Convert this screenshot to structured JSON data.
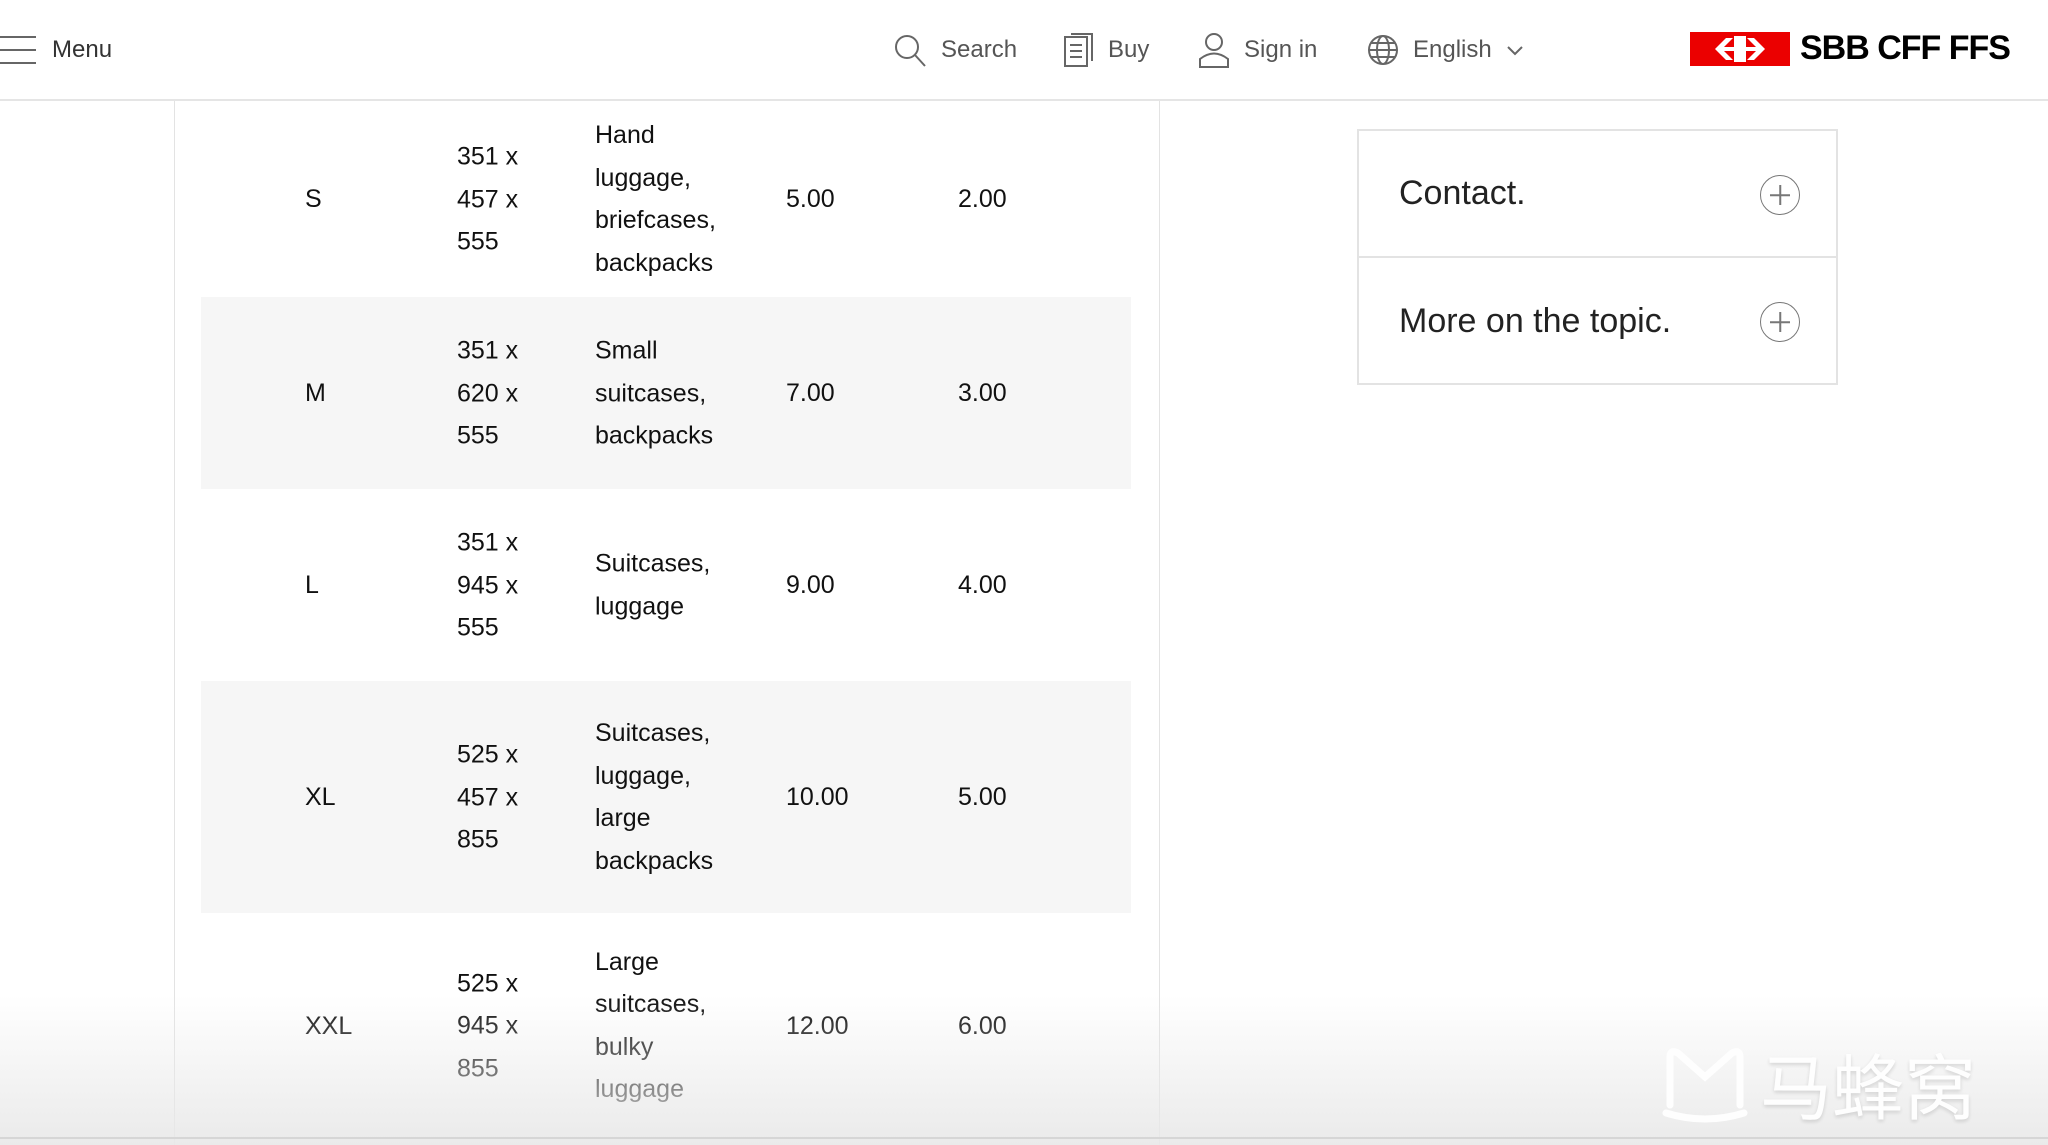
{
  "header": {
    "menu": "Menu",
    "search": "Search",
    "buy": "Buy",
    "signin": "Sign in",
    "language": "English",
    "logo": "SBB CFF FFS"
  },
  "table": {
    "rows": [
      {
        "size": "S",
        "dims": [
          "351 x",
          "457 x",
          "555"
        ],
        "desc": [
          "Hand",
          "luggage,",
          "briefcases,",
          "backpacks"
        ],
        "price1": "5.00",
        "price2": "2.00"
      },
      {
        "size": "M",
        "dims": [
          "351 x",
          "620 x",
          "555"
        ],
        "desc": [
          "Small",
          "suitcases,",
          "backpacks"
        ],
        "price1": "7.00",
        "price2": "3.00"
      },
      {
        "size": "L",
        "dims": [
          "351 x",
          "945 x",
          "555"
        ],
        "desc": [
          "Suitcases,",
          "luggage"
        ],
        "price1": "9.00",
        "price2": "4.00"
      },
      {
        "size": "XL",
        "dims": [
          "525 x",
          "457 x",
          "855"
        ],
        "desc": [
          "Suitcases,",
          "luggage,",
          "large",
          "backpacks"
        ],
        "price1": "10.00",
        "price2": "5.00"
      },
      {
        "size": "XXL",
        "dims": [
          "525 x",
          "945 x",
          "855"
        ],
        "desc": [
          "Large",
          "suitcases,",
          "bulky",
          "luggage"
        ],
        "price1": "12.00",
        "price2": "6.00"
      }
    ]
  },
  "sidebar": {
    "items": [
      {
        "label": "Contact."
      },
      {
        "label": "More on the topic."
      }
    ]
  },
  "watermark": "马蜂窝",
  "colors": {
    "brand": "#eb0000"
  }
}
